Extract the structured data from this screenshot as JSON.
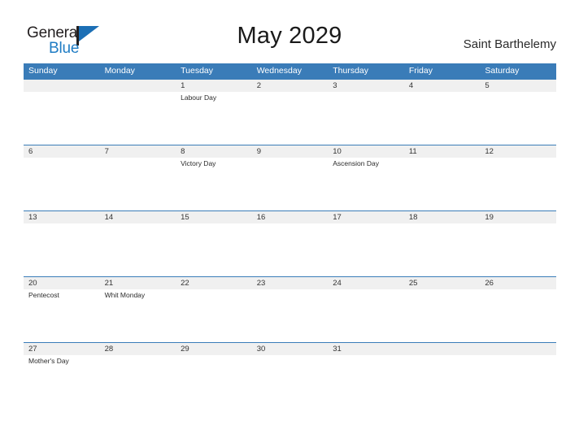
{
  "brand": {
    "name_part1": "General",
    "name_part2": "Blue",
    "flag_icon": "flag-icon",
    "accent_color": "#1c6fb5"
  },
  "header": {
    "title": "May 2029",
    "region": "Saint Barthelemy"
  },
  "calendar": {
    "header_bg": "#3a7cb8",
    "band_bg": "#f0f0f0",
    "weekdays": [
      "Sunday",
      "Monday",
      "Tuesday",
      "Wednesday",
      "Thursday",
      "Friday",
      "Saturday"
    ],
    "weeks": [
      {
        "days": [
          {
            "num": "",
            "event": ""
          },
          {
            "num": "",
            "event": ""
          },
          {
            "num": "1",
            "event": "Labour Day"
          },
          {
            "num": "2",
            "event": ""
          },
          {
            "num": "3",
            "event": ""
          },
          {
            "num": "4",
            "event": ""
          },
          {
            "num": "5",
            "event": ""
          }
        ]
      },
      {
        "days": [
          {
            "num": "6",
            "event": ""
          },
          {
            "num": "7",
            "event": ""
          },
          {
            "num": "8",
            "event": "Victory Day"
          },
          {
            "num": "9",
            "event": ""
          },
          {
            "num": "10",
            "event": "Ascension Day"
          },
          {
            "num": "11",
            "event": ""
          },
          {
            "num": "12",
            "event": ""
          }
        ]
      },
      {
        "days": [
          {
            "num": "13",
            "event": ""
          },
          {
            "num": "14",
            "event": ""
          },
          {
            "num": "15",
            "event": ""
          },
          {
            "num": "16",
            "event": ""
          },
          {
            "num": "17",
            "event": ""
          },
          {
            "num": "18",
            "event": ""
          },
          {
            "num": "19",
            "event": ""
          }
        ]
      },
      {
        "days": [
          {
            "num": "20",
            "event": "Pentecost"
          },
          {
            "num": "21",
            "event": "Whit Monday"
          },
          {
            "num": "22",
            "event": ""
          },
          {
            "num": "23",
            "event": ""
          },
          {
            "num": "24",
            "event": ""
          },
          {
            "num": "25",
            "event": ""
          },
          {
            "num": "26",
            "event": ""
          }
        ]
      },
      {
        "days": [
          {
            "num": "27",
            "event": "Mother's Day"
          },
          {
            "num": "28",
            "event": ""
          },
          {
            "num": "29",
            "event": ""
          },
          {
            "num": "30",
            "event": ""
          },
          {
            "num": "31",
            "event": ""
          },
          {
            "num": "",
            "event": ""
          },
          {
            "num": "",
            "event": ""
          }
        ]
      }
    ]
  }
}
